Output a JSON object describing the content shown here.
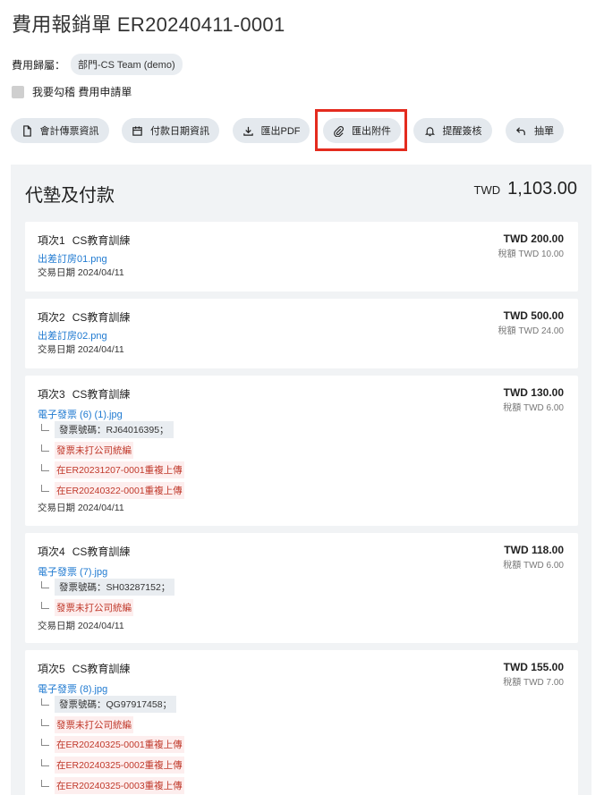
{
  "header": {
    "title": "費用報銷單 ER20240411-0001"
  },
  "belong": {
    "label": "費用歸屬：",
    "value": "部門-CS Team (demo)"
  },
  "checkbox": {
    "label": "我要勾稽 費用申請單"
  },
  "toolbar": {
    "accounting": "會計傳票資訊",
    "payment_date": "付款日期資訊",
    "export_pdf": "匯出PDF",
    "export_attachment": "匯出附件",
    "remind_sign": "提醒簽核",
    "withdraw": "抽單"
  },
  "section": {
    "title": "代墊及付款",
    "currency": "TWD",
    "total": "1,103.00"
  },
  "items": [
    {
      "no": "項次1",
      "name": "CS教育訓練",
      "file": "出差訂房01.png",
      "date": "交易日期 2024/04/11",
      "amount": "TWD 200.00",
      "tax": "稅額 TWD 10.00"
    },
    {
      "no": "項次2",
      "name": "CS教育訓練",
      "file": "出差訂房02.png",
      "date": "交易日期 2024/04/11",
      "amount": "TWD 500.00",
      "tax": "稅額 TWD 24.00"
    },
    {
      "no": "項次3",
      "name": "CS教育訓練",
      "file": "電子發票 (6) (1).jpg",
      "invoice": "發票號碼：RJ64016395；",
      "warn1": "發票未打公司統編",
      "warn2": "在ER20231207-0001重複上傳",
      "warn3": "在ER20240322-0001重複上傳",
      "date": "交易日期 2024/04/11",
      "amount": "TWD 130.00",
      "tax": "稅額 TWD 6.00"
    },
    {
      "no": "項次4",
      "name": "CS教育訓練",
      "file": "電子發票 (7).jpg",
      "invoice": "發票號碼：SH03287152；",
      "warn1": "發票未打公司統編",
      "date": "交易日期 2024/04/11",
      "amount": "TWD 118.00",
      "tax": "稅額 TWD 6.00"
    },
    {
      "no": "項次5",
      "name": "CS教育訓練",
      "file": "電子發票 (8).jpg",
      "invoice": "發票號碼：QG97917458；",
      "warn1": "發票未打公司統編",
      "warn2": "在ER20240325-0001重複上傳",
      "warn3": "在ER20240325-0002重複上傳",
      "warn4": "在ER20240325-0003重複上傳",
      "amount": "TWD 155.00",
      "tax": "稅額 TWD 7.00"
    }
  ],
  "icons": {
    "accounting": "document-icon",
    "payment_date": "calendar-icon",
    "export_pdf": "download-icon",
    "export_attachment": "paperclip-icon",
    "remind_sign": "bell-icon",
    "withdraw": "undo-arrow-icon"
  },
  "colors": {
    "link": "#1f7ad1",
    "warning": "#c0392b",
    "highlight": "#e42b1e",
    "button_bg": "#e4e9ee"
  }
}
